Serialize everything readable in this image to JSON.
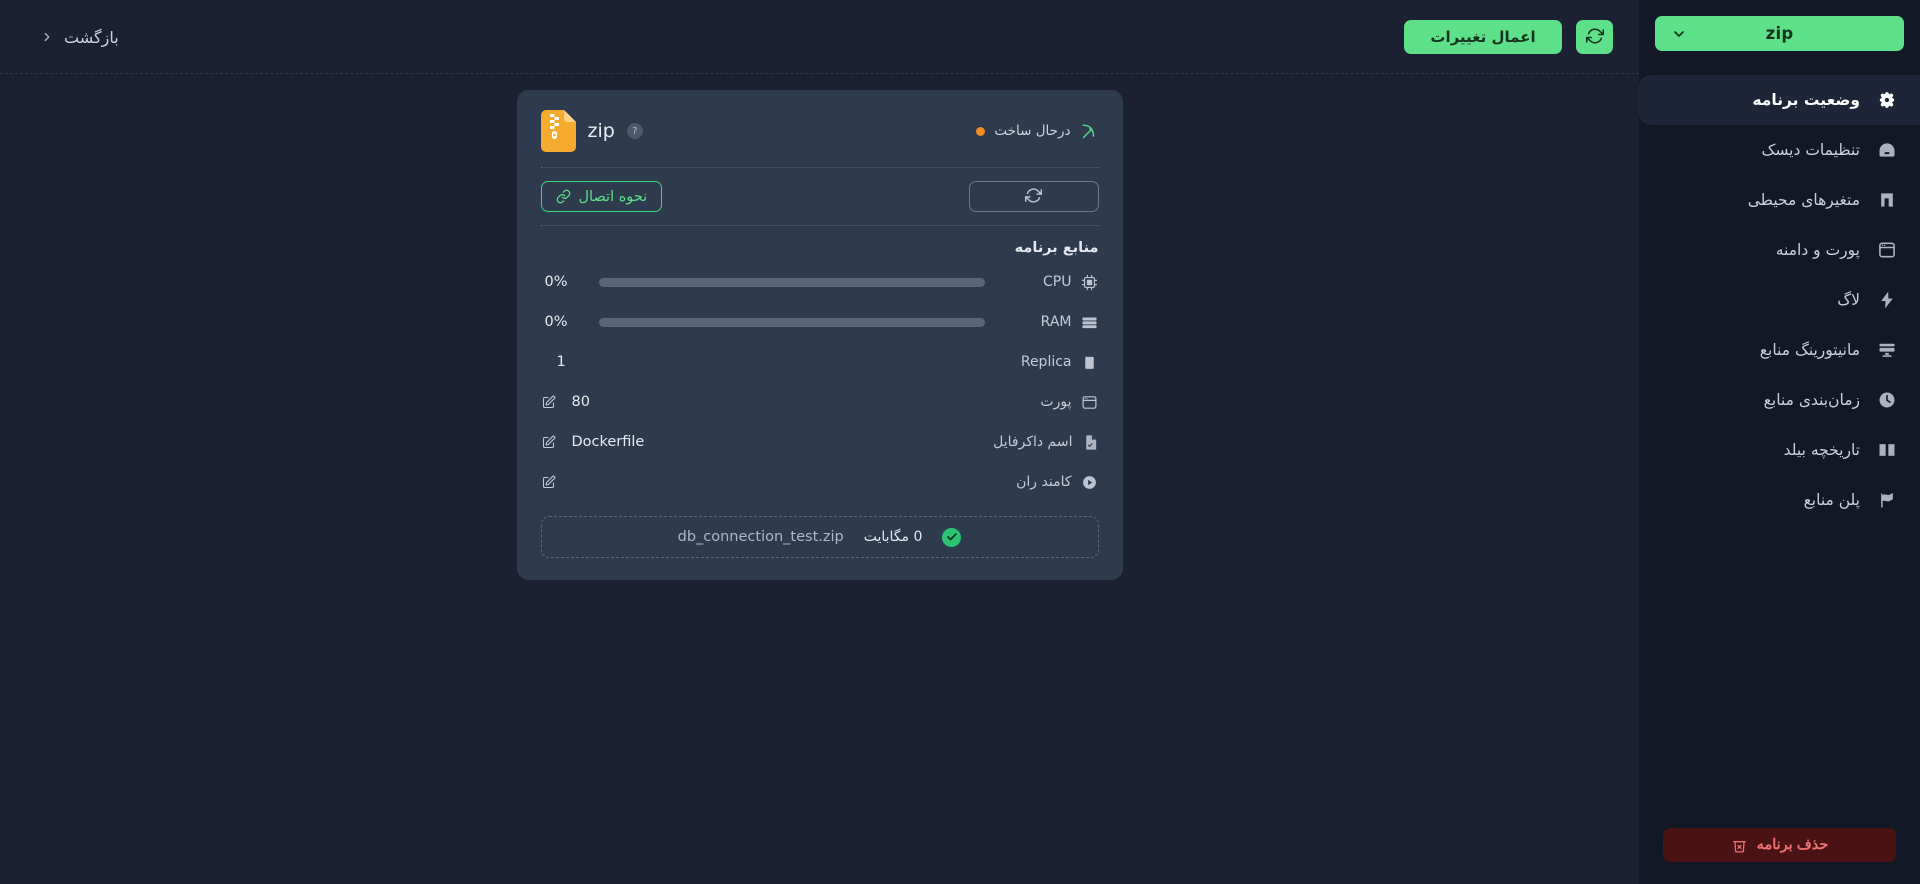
{
  "sidebar": {
    "app_selector": {
      "label": "zip",
      "icon": "chevron-down-icon"
    },
    "items": [
      {
        "label": "وضعیت برنامه",
        "icon": "gear-icon",
        "active": true
      },
      {
        "label": "تنظیمات دیسک",
        "icon": "disk-icon",
        "active": false
      },
      {
        "label": "متغیرهای محیطی",
        "icon": "env-variables-icon",
        "active": false
      },
      {
        "label": "پورت و دامنه",
        "icon": "browser-window-icon",
        "active": false
      },
      {
        "label": "لاگ",
        "icon": "lightning-icon",
        "active": false
      },
      {
        "label": "مانیتورینگ منابع",
        "icon": "monitor-icon",
        "active": false
      },
      {
        "label": "زمان‌بندی منابع",
        "icon": "clock-icon",
        "active": false
      },
      {
        "label": "تاریخچه بیلد",
        "icon": "book-icon",
        "active": false
      },
      {
        "label": "پلن منابع",
        "icon": "flag-icon",
        "active": false
      }
    ],
    "delete_button": {
      "label": "حذف برنامه",
      "icon": "trash-x-icon"
    }
  },
  "topbar": {
    "back": {
      "label": "بازگشت",
      "icon": "chevron-right-icon"
    },
    "apply_label": "اعمال تغییرات",
    "reload_icon": "refresh-icon"
  },
  "card": {
    "app_name": "zip",
    "app_icon": "zip-file-icon",
    "help_icon": "question-mark-icon",
    "status": {
      "text": "درحال ساخت",
      "dot_color": "#f08a24",
      "icon": "build-pickaxe-icon"
    },
    "connection_button": {
      "label": "نحوه اتصال",
      "icon": "link-icon"
    },
    "restart_button": {
      "label": "",
      "icon": "refresh-icon"
    },
    "resources_title": "منابع برنامه",
    "resources": [
      {
        "label": "CPU",
        "icon": "cpu-chip-icon",
        "type": "bar",
        "value": "0%",
        "percent": 0
      },
      {
        "label": "RAM",
        "icon": "ram-stick-icon",
        "type": "bar",
        "value": "0%",
        "percent": 0
      },
      {
        "label": "Replica",
        "icon": "replica-icon",
        "type": "plain",
        "value": "1"
      },
      {
        "label": "پورت",
        "icon": "browser-window-icon",
        "type": "editable",
        "value": "80"
      },
      {
        "label": "اسم داکرفایل",
        "icon": "dockerfile-icon",
        "type": "editable",
        "value": "Dockerfile"
      },
      {
        "label": "کامند ران",
        "icon": "play-circle-icon",
        "type": "editable",
        "value": ""
      }
    ],
    "file": {
      "name": "db_connection_test.zip",
      "size": "0 مگابایت",
      "status_icon": "check-circle-icon"
    }
  },
  "colors": {
    "accent_green": "#5de089",
    "page_bg": "#1b2133",
    "sidebar_bg": "#131827",
    "card_bg": "#2e3a4e",
    "danger": "#f07171",
    "status_orange": "#f08a24"
  }
}
